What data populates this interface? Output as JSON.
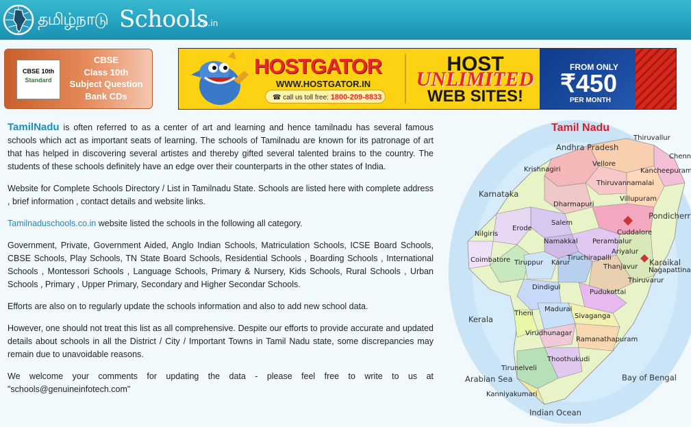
{
  "header": {
    "logo_tamil": "தமிழ்நாடு",
    "logo_main": "Schools",
    "logo_suffix": ".co.in"
  },
  "cbse_ad": {
    "book_title": "CBSE 10th",
    "book_subtitle": "Standard",
    "lines": [
      "CBSE",
      "Class 10th",
      "Subject Question",
      "Bank CDs"
    ]
  },
  "hostgator_ad": {
    "brand": "HOSTGATOR",
    "url": "WWW.HOSTGATOR.IN",
    "call_label": "call us toll free:",
    "call_number": "1800-209-8833",
    "headline_1": "HOST",
    "headline_2": "UNLIMITED",
    "headline_3": "WEB SITES!",
    "from_label": "FROM ONLY",
    "price": "₹450",
    "per_label": "PER MONTH"
  },
  "content": {
    "lead_word": "TamilNadu",
    "para1_rest": " is often referred to as a center of art and learning and hence tamilnadu has several famous schools which act as important seats of learning. The schools of Tamilnadu are known for its patronage of art that has helped in discovering several artistes and thereby gifted several talented brains to the country. The students of these schools definitely have an edge over their counterparts in the other states of India.",
    "para2": "Website for Complete Schools Directory / List in Tamilnadu State. Schools are listed here with complete address , brief information , contact details and website links.",
    "site_link": "Tamilnaduschools.co.in",
    "para3_rest": " website listed the schools in the following all category.",
    "para4": "Government, Private, Government Aided, Anglo Indian Schools, Matriculation Schools, ICSE Board Schools, CBSE Schools, Play Schools, TN State Board Schools, Residential Schools , Boarding Schools , International Schools , Montessori Schools , Language Schools, Primary & Nursery, Kids Schools, Rural Schools , Urban Schools , Primary , Upper Primary, Secondary and Higher Secondar Schools.",
    "para5": "Efforts are also on to regularly update the schools information and also to add new school data.",
    "para6": "However, one should not treat this list as all comprehensive. Despite our efforts to provide accurate and updated details about schools in all the District / City / Important Towns in Tamil Nadu state, some discrepancies may remain due to unavoidable reasons.",
    "para7": "We welcome your comments for updating the data - please feel free to write to us at \"schools@genuineinfotech.com\""
  },
  "map": {
    "title": "Tamil Nadu",
    "neighbors": {
      "andhra": "Andhra Pradesh",
      "karnataka": "Karnataka",
      "kerala": "Kerala",
      "pondicherry": "Pondicherry",
      "karaikal": "Karaikal",
      "nagapattinam": "Nagapattinam",
      "bay": "Bay of Bengal",
      "arabian": "Arabian Sea",
      "indian": "Indian Ocean"
    },
    "districts": {
      "thiruvallur": "Thiruvallur",
      "chennai": "Chennai",
      "vellore": "Vellore",
      "kancheepuram": "Kancheepuram",
      "krishnagiri": "Krishnagiri",
      "thiruvannamalai": "Thiruvannamalai",
      "villupuram": "Villupuram",
      "dharmapuri": "Dharmapuri",
      "salem": "Salem",
      "cuddalore": "Cuddalore",
      "erode": "Erode",
      "nilgiris": "Nilgiris",
      "namakkal": "Namakkal",
      "perambalur": "Perambalur",
      "ariyalur": "Ariyalur",
      "coimbatore": "Coimbatore",
      "tiruppur": "Tiruppur",
      "karur": "Karur",
      "tiruchirapalli": "Tiruchirapalli",
      "thanjavur": "Thanjavur",
      "thiruvarur": "Thiruvarur",
      "dindigul": "Dindigul",
      "pudukottai": "Pudukottai",
      "theni": "Theni",
      "madurai": "Madurai",
      "sivaganga": "Sivaganga",
      "virudhunagar": "Virudhunagar",
      "ramanathapuram": "Ramanathapuram",
      "thoothukudi": "Thoothukudi",
      "tirunelveli": "Tirunelveli",
      "kanniyakumari": "Kanniyakumari"
    }
  }
}
